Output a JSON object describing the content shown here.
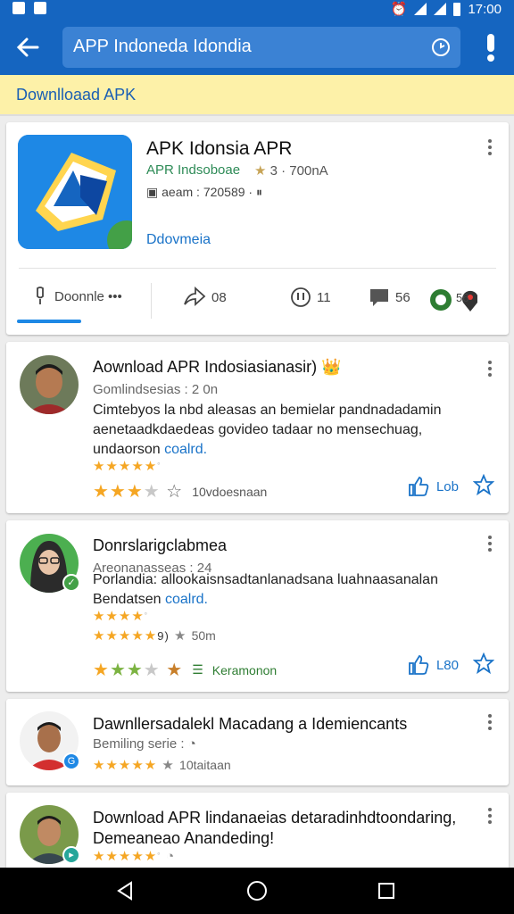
{
  "status": {
    "time": "17:00"
  },
  "search": {
    "query": "APP Indoneda Idondia"
  },
  "banner": {
    "text": "Downlloaad APK"
  },
  "app": {
    "title": "APK Idonsia APR",
    "developer": "APR Indsoboae",
    "rating": "3 · 700nA",
    "size": "aeam : 720589 ·",
    "category": "Ddovmeia",
    "actions": [
      {
        "label": "Doonnle •••",
        "icon": "download-icon"
      },
      {
        "label": "08",
        "icon": "share-icon"
      },
      {
        "label": "11",
        "icon": "info-icon"
      },
      {
        "label": "56",
        "icon": "comment-icon"
      },
      {
        "label": "56",
        "icon": "location-icon"
      }
    ]
  },
  "reviews": [
    {
      "title": "Aownload APR Indosiasianasir)",
      "subtitle": "Gomlindsesias : 2 0n",
      "body": "Cimtebyos la nbd aleasas an bemielar pandnadadamin aenetaadkdaedeas govideo tadaar no mensechuag, undaorson",
      "link": "coalrd.",
      "stars_text": "★★★★★",
      "rating_note": "10vdoesnaan",
      "likes": "Lob",
      "avatar_color": "#8d5a3b"
    },
    {
      "title": "Donrslarigclabmea",
      "subtitle": "Areonanasseas : 24",
      "body": "Porlandia: allookaisnsadtanlanadsana luahnaasanalan Bendatsen",
      "link": "coalrd.",
      "stars_text": "★★★★★",
      "stars_line2": "9)",
      "stars_line2_note": "50m",
      "footer_note": "Keramonon",
      "likes": "L80",
      "avatar_color": "#2e7d32"
    },
    {
      "title": "Dawnllersadalekl Macadang a Idemiencants",
      "subtitle": "Bemiling serie :",
      "rating_note": "10taitaan",
      "avatar_color": "#c62828"
    },
    {
      "title": "Download APR lindanaeias detaradinhdtoondaring,",
      "subtitle": "Demeaneao Anandeding!",
      "avatar_color": "#5d4037"
    }
  ],
  "colors": {
    "primary": "#1565c0",
    "accent": "#1e88e5",
    "star": "#f5a623",
    "banner": "#fdf1a8"
  }
}
